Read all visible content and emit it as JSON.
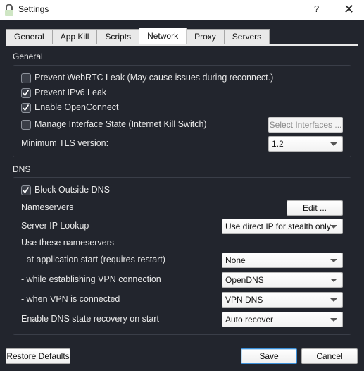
{
  "window": {
    "title": "Settings",
    "help_label": "?",
    "close_label": "✕"
  },
  "tabs": [
    {
      "label": "General",
      "active": false
    },
    {
      "label": "App Kill",
      "active": false
    },
    {
      "label": "Scripts",
      "active": false
    },
    {
      "label": "Network",
      "active": true
    },
    {
      "label": "Proxy",
      "active": false
    },
    {
      "label": "Servers",
      "active": false
    }
  ],
  "general": {
    "section_label": "General",
    "prevent_webrtc": {
      "label": "Prevent WebRTC Leak (May cause issues during reconnect.)",
      "checked": false
    },
    "prevent_ipv6": {
      "label": "Prevent IPv6 Leak",
      "checked": true
    },
    "enable_openconnect": {
      "label": "Enable OpenConnect",
      "checked": true
    },
    "manage_interface": {
      "label": "Manage Interface State (Internet Kill Switch)",
      "checked": false
    },
    "select_interfaces_label": "Select Interfaces ...",
    "min_tls_label": "Minimum TLS version:",
    "min_tls_value": "1.2"
  },
  "dns": {
    "section_label": "DNS",
    "block_outside": {
      "label": "Block Outside DNS",
      "checked": true
    },
    "nameservers_label": "Nameservers",
    "edit_label": "Edit ...",
    "server_ip_lookup_label": "Server IP Lookup",
    "server_ip_lookup_value": "Use direct IP for stealth only",
    "use_nameservers_label": "Use these nameservers",
    "app_start_label": " - at application start (requires restart)",
    "app_start_value": "None",
    "establishing_label": " - while establishing VPN connection",
    "establishing_value": "OpenDNS",
    "connected_label": " - when VPN is connected",
    "connected_value": "VPN DNS",
    "recovery_label": "Enable DNS state recovery on start",
    "recovery_value": "Auto recover"
  },
  "footer": {
    "restore_label": "Restore Defaults",
    "save_label": "Save",
    "cancel_label": "Cancel"
  }
}
